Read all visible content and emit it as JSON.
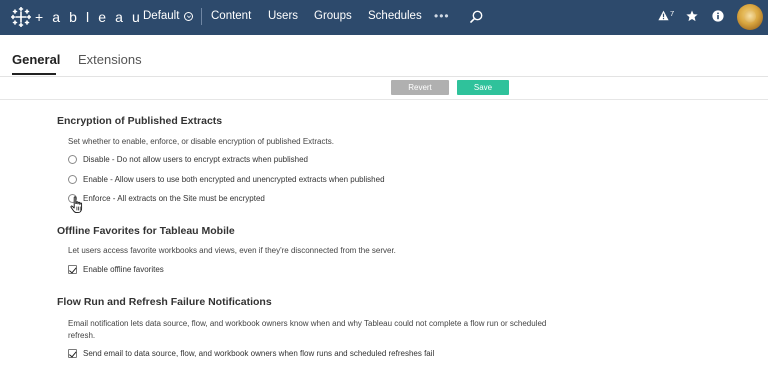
{
  "brand": {
    "logo_text": "+ a b l e a u",
    "nav_bg": "#2d4a6c"
  },
  "topnav": {
    "site_label": "Default",
    "items": [
      "Content",
      "Users",
      "Groups",
      "Schedules"
    ],
    "more_label": "•••",
    "alert_count": "7",
    "icons": [
      "search-icon",
      "alert-icon",
      "star-icon",
      "info-icon",
      "avatar"
    ]
  },
  "tabs": {
    "general": "General",
    "extensions": "Extensions",
    "active": "General"
  },
  "actions": {
    "revert_label": "Revert",
    "save_label": "Save",
    "save_color": "#2fc29b",
    "revert_color": "#b0b0b0"
  },
  "encryption": {
    "title": "Encryption of Published Extracts",
    "description": "Set whether to enable, enforce, or disable encryption of published Extracts.",
    "options": [
      "Disable - Do not allow users to encrypt extracts when published",
      "Enable - Allow users to use both encrypted and unencrypted extracts when published",
      "Enforce - All extracts on the Site must be encrypted"
    ],
    "selected_index": null
  },
  "offline": {
    "title": "Offline Favorites for Tableau Mobile",
    "description": "Let users access favorite workbooks and views, even if they're disconnected from the server.",
    "checkbox_label": "Enable offline favorites",
    "checked": true
  },
  "flow": {
    "title": "Flow Run and Refresh Failure Notifications",
    "description_line1": "Email notification lets data source, flow, and workbook owners know when and why Tableau could not complete a flow run or scheduled",
    "description_line2": "refresh.",
    "checkbox_label": "Send email to data source, flow, and workbook owners when flow runs and scheduled refreshes fail",
    "checked": true
  }
}
